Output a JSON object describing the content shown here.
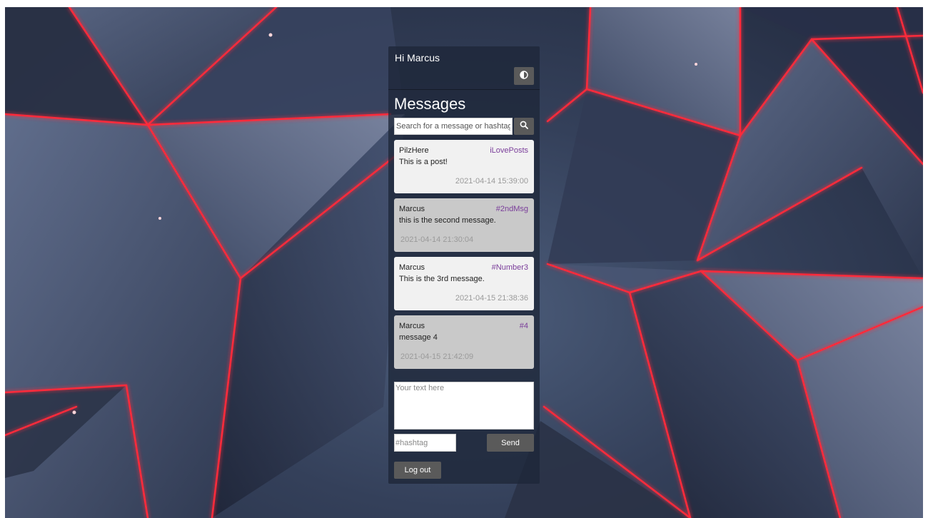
{
  "header": {
    "greeting": "Hi Marcus",
    "theme_toggle_icon": "contrast-icon"
  },
  "main": {
    "title": "Messages",
    "search": {
      "placeholder": "Search for a message or hashtag",
      "value": "",
      "button_icon": "search-icon"
    },
    "messages": [
      {
        "author": "PilzHere",
        "hashtag": "iLovePosts",
        "text": "This is a post!",
        "timestamp": "2021-04-14 15:39:00"
      },
      {
        "author": "Marcus",
        "hashtag": "#2ndMsg",
        "text": "this is the second message.",
        "timestamp": "2021-04-14 21:30:04"
      },
      {
        "author": "Marcus",
        "hashtag": "#Number3",
        "text": "This is the 3rd message.",
        "timestamp": "2021-04-15 21:38:36"
      },
      {
        "author": "Marcus",
        "hashtag": "#4",
        "text": "message 4",
        "timestamp": "2021-04-15 21:42:09"
      }
    ]
  },
  "composer": {
    "text_placeholder": "Your text here",
    "text_value": "",
    "hashtag_placeholder": "#hashtag",
    "hashtag_value": "",
    "send_label": "Send"
  },
  "footer": {
    "logout_label": "Log out"
  },
  "colors": {
    "panel": "#1e2638",
    "button": "#5a5a5a",
    "hashtag": "#7a3d9a",
    "card_light": "#f1f1f1",
    "card_dark": "#c9c9c9",
    "timestamp": "#9a9a9a",
    "background_accent": "#ff2a3a"
  }
}
